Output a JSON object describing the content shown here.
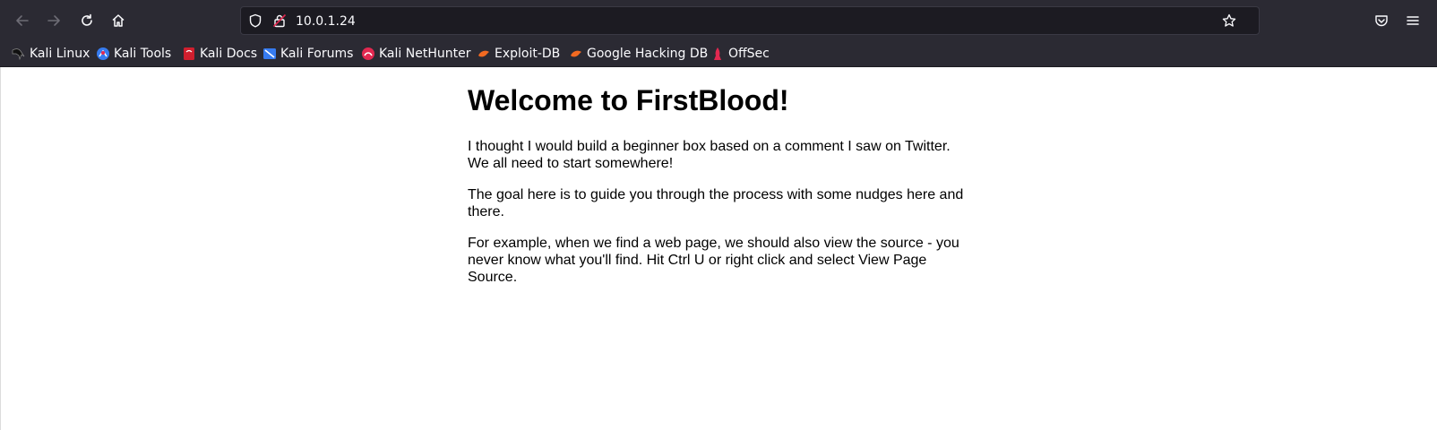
{
  "browser": {
    "address": "10.0.1.24",
    "nav": {
      "back": "back-arrow-icon",
      "forward": "forward-arrow-icon",
      "reload": "reload-icon",
      "home": "home-icon"
    },
    "bookmarks": [
      {
        "label": "Kali Linux",
        "icon": "kali-dragon-icon"
      },
      {
        "label": "Kali Tools",
        "icon": "kali-tools-icon"
      },
      {
        "label": "Kali Docs",
        "icon": "kali-docs-icon"
      },
      {
        "label": "Kali Forums",
        "icon": "kali-forums-icon"
      },
      {
        "label": "Kali NetHunter",
        "icon": "kali-nethunter-icon"
      },
      {
        "label": "Exploit-DB",
        "icon": "exploit-db-icon"
      },
      {
        "label": "Google Hacking DB",
        "icon": "ghdb-icon"
      },
      {
        "label": "OffSec",
        "icon": "offsec-icon"
      }
    ],
    "colors": {
      "chrome": "#2b2a33",
      "urlbar": "#1c1b22",
      "text": "#fbfbfe"
    }
  },
  "page": {
    "heading": "Welcome to FirstBlood!",
    "paragraph1_line1": "I thought I would build a beginner box based on a comment I saw on Twitter.",
    "paragraph1_line2": "We all need to start somewhere!",
    "paragraph2_line1": "The goal here is to guide you through the process with some nudges here and",
    "paragraph2_line2": "there.",
    "paragraph3_line1": "For example, when we find a web page, we should also view the source - you",
    "paragraph3_line2": "never know what you'll find. Hit Ctrl U or right click and select View Page",
    "paragraph3_line3": "Source."
  }
}
